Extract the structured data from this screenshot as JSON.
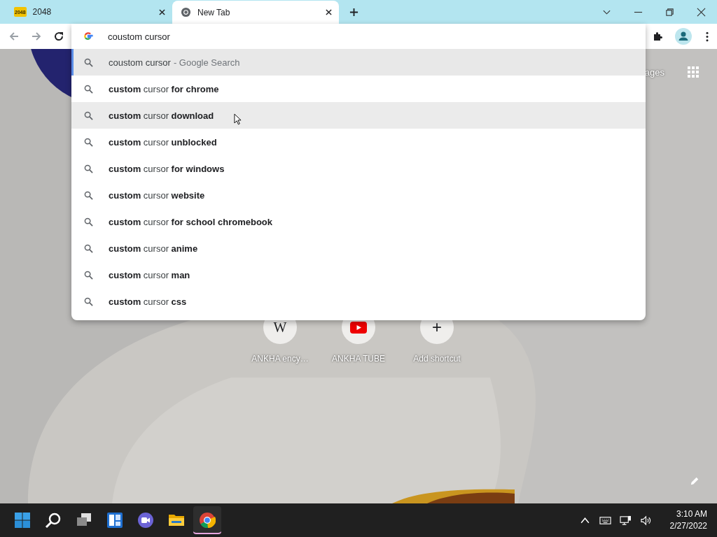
{
  "tabs": [
    {
      "title": "2048",
      "kind": "badge",
      "favicon_text": "2048",
      "selected": false
    },
    {
      "title": "New Tab",
      "kind": "chrome",
      "selected": true
    }
  ],
  "omnibox": {
    "value": "coustom cursor"
  },
  "suggestions": [
    {
      "text": "coustom cursor",
      "suffix": "- Google Search",
      "selected": true,
      "hovered": false
    },
    {
      "text": "**custom** cursor **for chrome**",
      "selected": false,
      "hovered": false
    },
    {
      "text": "**custom** cursor **download**",
      "selected": false,
      "hovered": true
    },
    {
      "text": "**custom** cursor **unblocked**",
      "selected": false,
      "hovered": false
    },
    {
      "text": "**custom** cursor **for windows**",
      "selected": false,
      "hovered": false
    },
    {
      "text": "**custom** cursor **website**",
      "selected": false,
      "hovered": false
    },
    {
      "text": "**custom** cursor **for school chromebook**",
      "selected": false,
      "hovered": false
    },
    {
      "text": "**custom** cursor **anime**",
      "selected": false,
      "hovered": false
    },
    {
      "text": "**custom** cursor **man**",
      "selected": false,
      "hovered": false
    },
    {
      "text": "**custom** cursor **css**",
      "selected": false,
      "hovered": false
    }
  ],
  "images_link": "ages",
  "shortcuts": [
    {
      "kind": "wikipedia",
      "glyph": "W",
      "label": "ANKHA ency…"
    },
    {
      "kind": "youtube",
      "label": "ANKHA TUBE"
    },
    {
      "kind": "add",
      "glyph": "+",
      "label": "Add shortcut"
    }
  ],
  "taskbar": {
    "apps": [
      {
        "kind": "start",
        "active": false
      },
      {
        "kind": "search",
        "active": false
      },
      {
        "kind": "taskview",
        "active": false
      },
      {
        "kind": "widgets",
        "active": false
      },
      {
        "kind": "chat",
        "active": false
      },
      {
        "kind": "explorer",
        "active": false
      },
      {
        "kind": "chrome",
        "active": true
      }
    ],
    "time": "3:10 AM",
    "date": "2/27/2022"
  }
}
